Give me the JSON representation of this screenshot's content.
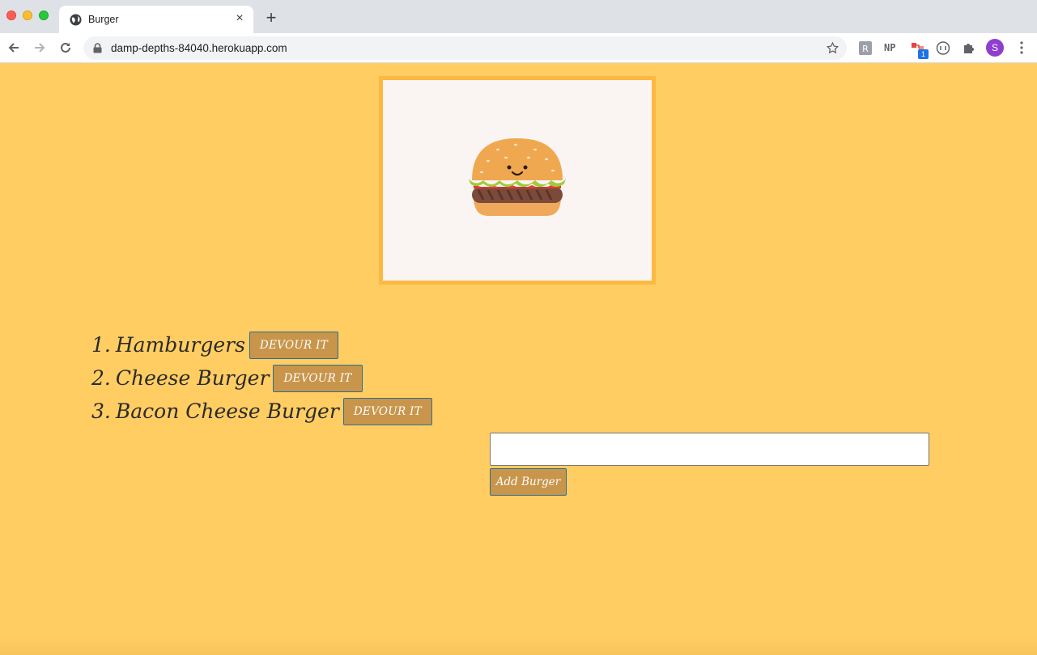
{
  "browser": {
    "tab_title": "Burger",
    "tab_close": "×",
    "new_tab": "+",
    "url": "damp-depths-84040.herokuapp.com",
    "extensions": {
      "np_label": "NP",
      "badge_count": "1"
    },
    "profile_initial": "S"
  },
  "page": {
    "background": "#ffcd62",
    "hero_border": "#fdb841",
    "burgers": [
      {
        "number": "1.",
        "name": "Hamburgers",
        "button": "DEVOUR IT"
      },
      {
        "number": "2.",
        "name": "Cheese Burger",
        "button": "DEVOUR IT"
      },
      {
        "number": "3.",
        "name": "Bacon Cheese Burger",
        "button": "DEVOUR IT"
      }
    ],
    "add_form": {
      "input_value": "",
      "button_label": "Add Burger"
    },
    "button_color": "#c8954b"
  }
}
